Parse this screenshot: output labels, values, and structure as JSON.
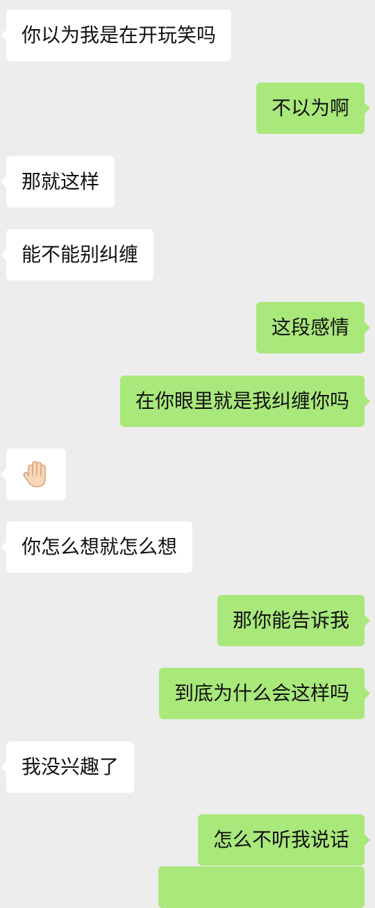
{
  "colors": {
    "background": "#ededed",
    "incoming_bubble": "#ffffff",
    "outgoing_bubble": "#a9e87b",
    "text": "#111111"
  },
  "messages": [
    {
      "side": "incoming",
      "text": "你以为我是在开玩笑吗"
    },
    {
      "side": "outgoing",
      "text": "不以为啊"
    },
    {
      "side": "incoming",
      "text": "那就这样"
    },
    {
      "side": "incoming",
      "text": "能不能别纠缠"
    },
    {
      "side": "outgoing",
      "text": "这段感情"
    },
    {
      "side": "outgoing",
      "text": "在你眼里就是我纠缠你吗"
    },
    {
      "side": "incoming",
      "icon": "raised-hand-emoji-icon"
    },
    {
      "side": "incoming",
      "text": "你怎么想就怎么想"
    },
    {
      "side": "outgoing",
      "text": "那你能告诉我"
    },
    {
      "side": "outgoing",
      "text": "到底为什么会这样吗"
    },
    {
      "side": "incoming",
      "text": "我没兴趣了"
    },
    {
      "side": "outgoing",
      "text": "怎么不听我说话"
    },
    {
      "side": "outgoing",
      "text": "",
      "partial": true
    }
  ]
}
